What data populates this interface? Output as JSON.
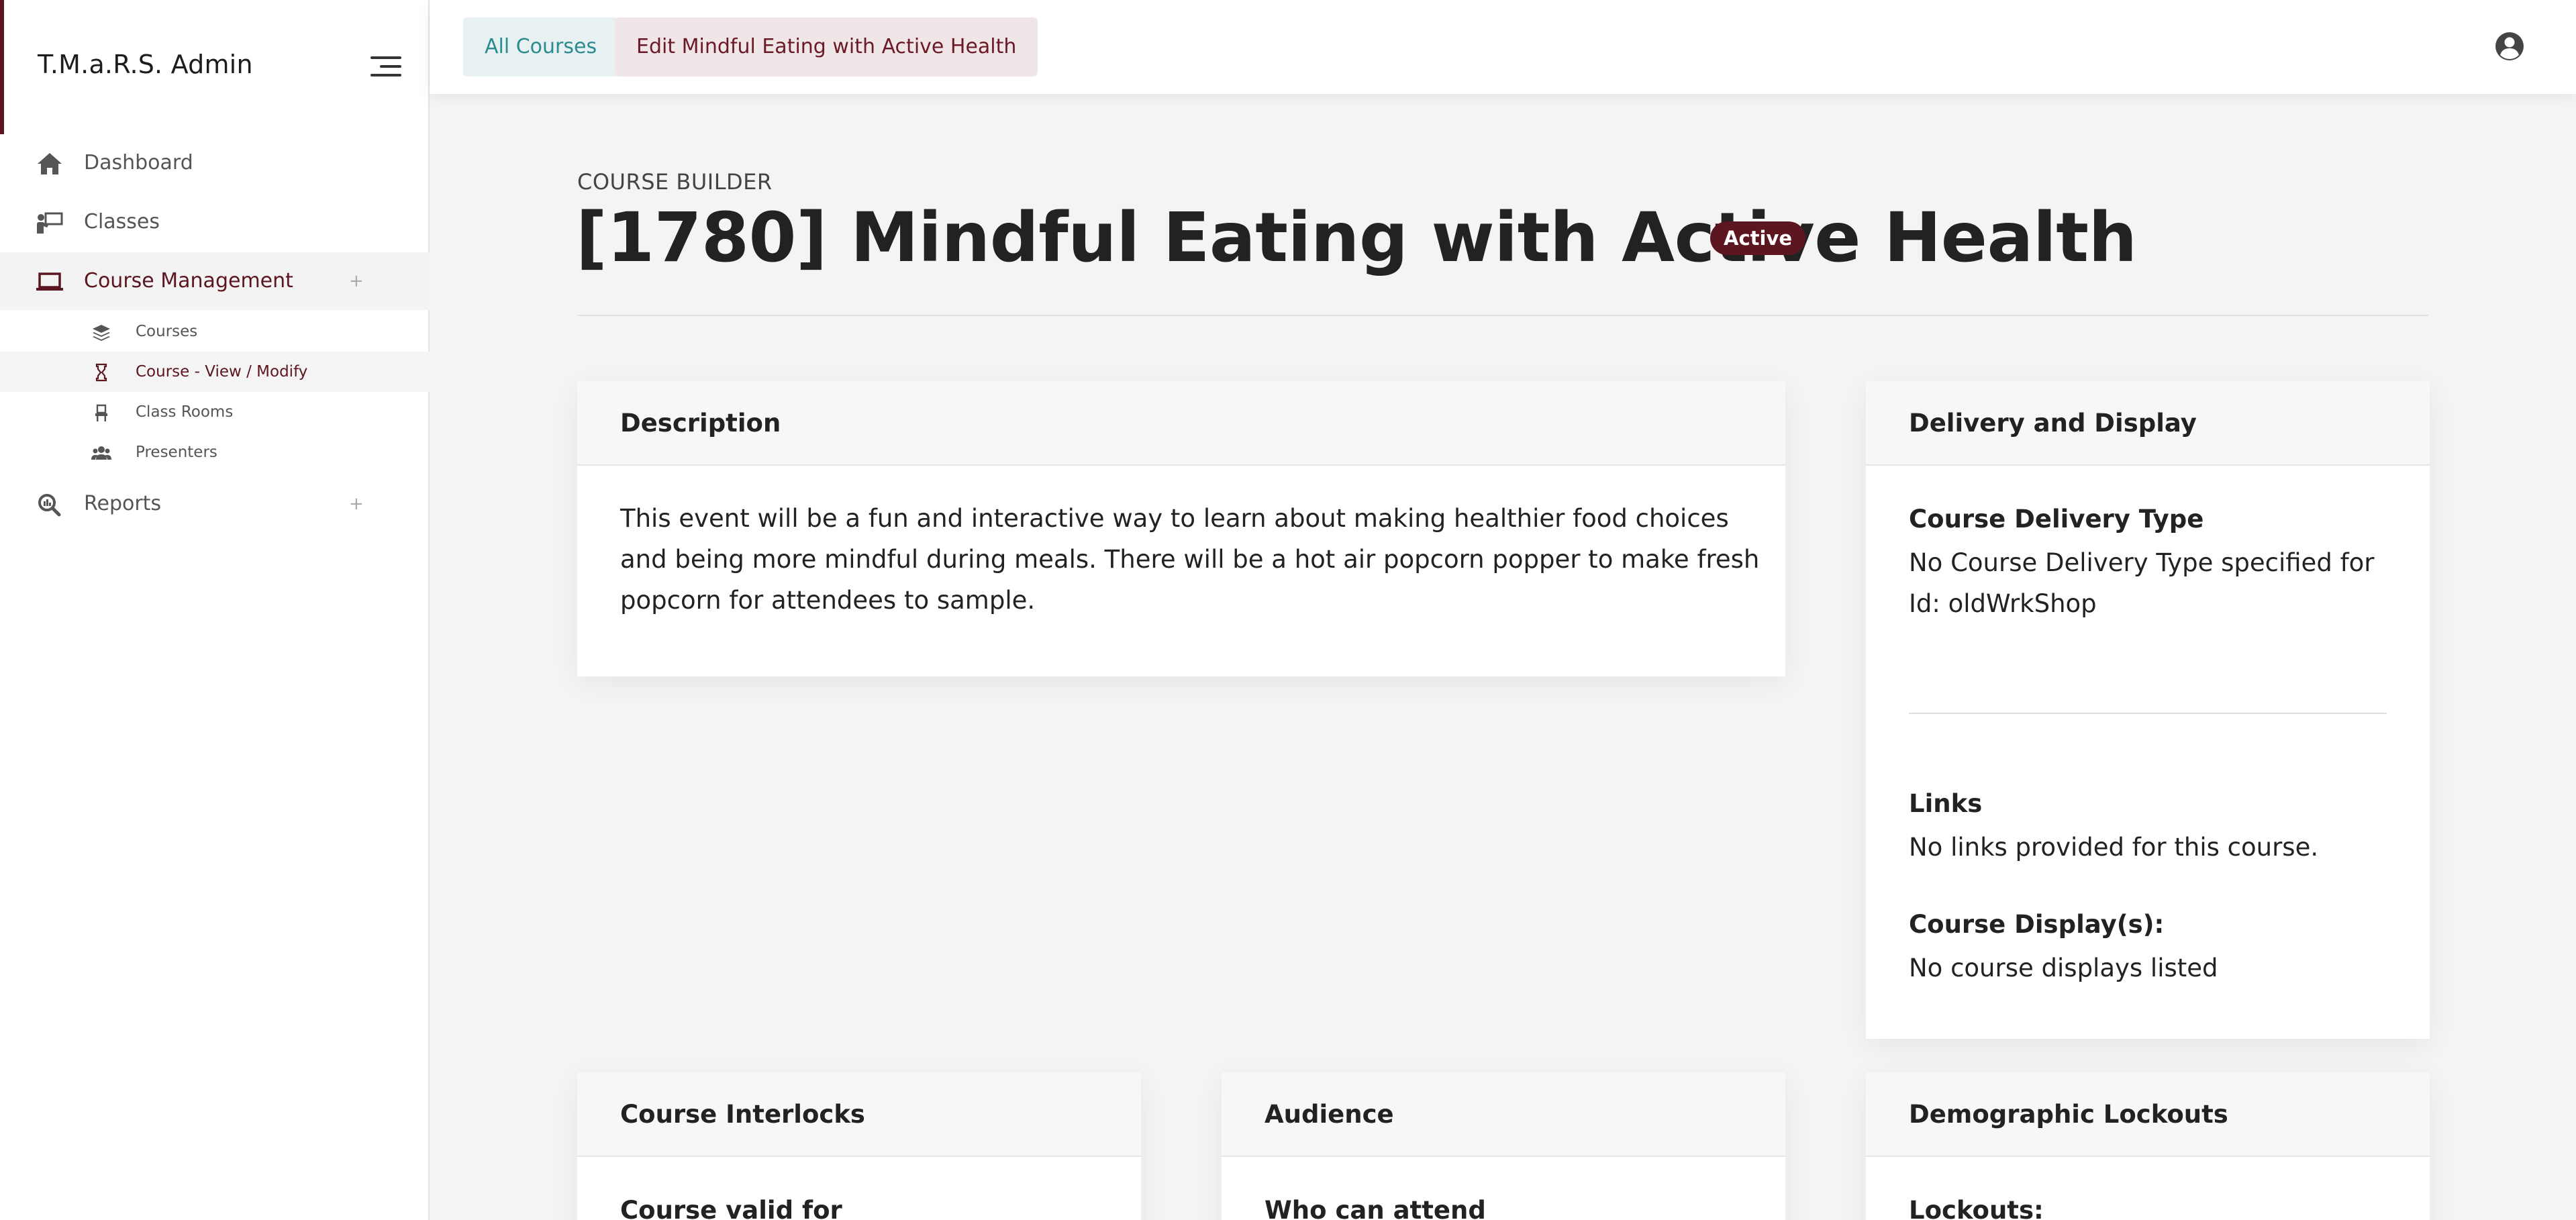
{
  "app": {
    "title": "T.M.a.R.S. Admin"
  },
  "sidebar": {
    "items": [
      {
        "label": "Dashboard",
        "icon": "home-icon"
      },
      {
        "label": "Classes",
        "icon": "presenter-board-icon"
      },
      {
        "label": "Course Management",
        "icon": "laptop-icon",
        "expand": "+",
        "active": true
      },
      {
        "label": "Reports",
        "icon": "search-report-icon",
        "expand": "+"
      }
    ],
    "sub_items": [
      {
        "label": "Courses",
        "icon": "layers-icon"
      },
      {
        "label": "Course - View / Modify",
        "icon": "hourglass-icon",
        "active": true
      },
      {
        "label": "Class Rooms",
        "icon": "chair-icon"
      },
      {
        "label": "Presenters",
        "icon": "users-icon"
      }
    ]
  },
  "topbar": {
    "crumbs": [
      "All Courses",
      "Edit Mindful Eating with Active Health"
    ],
    "user_icon": "user-circle-icon"
  },
  "page": {
    "eyebrow": "COURSE BUILDER",
    "title": "[1780] Mindful Eating with Active Health",
    "status": "Active"
  },
  "cards": {
    "description": {
      "title": "Description",
      "text": "This event will be a fun and interactive way to learn about making healthier food choices and being more mindful during meals. There will be a hot air popcorn popper to make fresh popcorn for attendees to sample."
    },
    "delivery": {
      "title": "Delivery and Display",
      "delivery_type_title": "Course Delivery Type",
      "delivery_type_text": "No Course Delivery Type specified for Id: oldWrkShop",
      "links_title": "Links",
      "links_text": "No links provided for this course.",
      "displays_title": "Course Display(s):",
      "displays_text": "No course displays listed"
    },
    "interlocks": {
      "title": "Course Interlocks",
      "sub": "Course valid for"
    },
    "audience": {
      "title": "Audience",
      "sub": "Who can attend"
    },
    "lockouts": {
      "title": "Demographic Lockouts",
      "sub": "Lockouts:"
    }
  },
  "colors": {
    "brand": "#5c1620",
    "teal": "#2b8b8f"
  }
}
